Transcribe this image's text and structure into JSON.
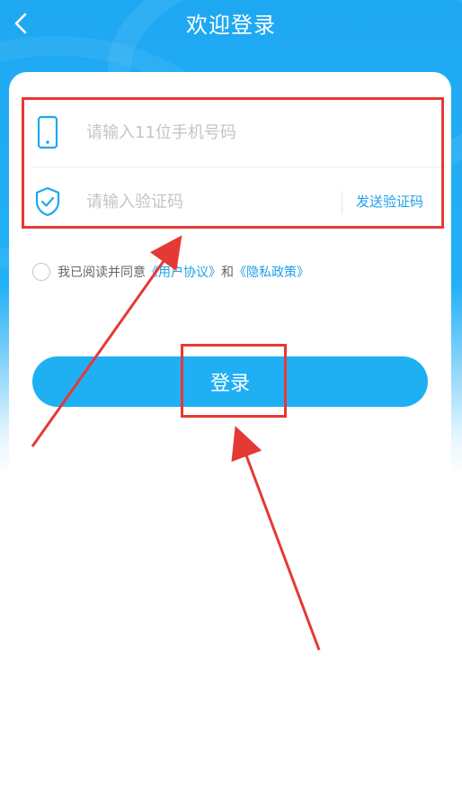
{
  "header": {
    "title": "欢迎登录"
  },
  "form": {
    "phone_placeholder": "请输入11位手机号码",
    "code_placeholder": "请输入验证码",
    "send_code_label": "发送验证码"
  },
  "agreement": {
    "prefix": "我已阅读并同意",
    "user_agreement": "《用户协议》",
    "and": "和",
    "privacy_policy": "《隐私政策》"
  },
  "login_button": {
    "label": "登录"
  },
  "colors": {
    "primary": "#1fb0f4",
    "link": "#1fa0ea",
    "annotation_red": "#e53935"
  }
}
